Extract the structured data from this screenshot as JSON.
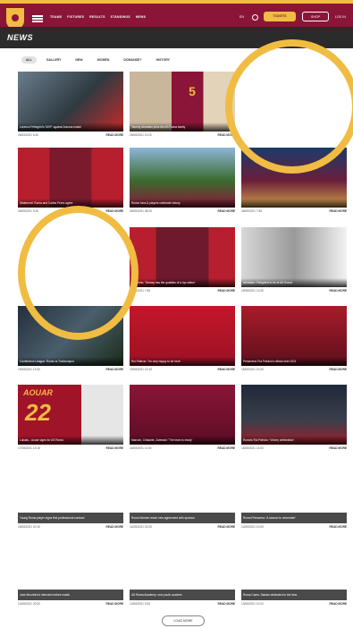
{
  "nav": {
    "items": [
      "TEAMS",
      "FIXTURES",
      "RESULTS",
      "STANDINGS",
      "NEWS"
    ],
    "lang": "EN",
    "tickets_label": "TICKETS",
    "shop_label": "SHOP",
    "login_label": "LOG IN"
  },
  "page": {
    "title": "NEWS",
    "filters": [
      "ALL",
      "GALLERY",
      "NEW",
      "WOMEN",
      "DOMANDE?",
      "HISTORY"
    ],
    "active_filter": 0
  },
  "cards": [
    {
      "caption": "Lorenzo Pellegrini's 'MVP' against Ancona match",
      "date": "26/08/2021 6:40",
      "readmore": "READ MORE"
    },
    {
      "caption": "Tammy Abraham joins the AS Roma family",
      "date": "26/08/2021 10:20",
      "readmore": "READ MORE"
    },
    {
      "caption": "",
      "date": "",
      "readmore": ""
    },
    {
      "caption": "Statement: Roma and Carles Perez agree",
      "date": "26/08/2021 9:30",
      "readmore": "READ MORE"
    },
    {
      "caption": "Roma: fans & players celebrate victory",
      "date": "26/08/2021 08:25",
      "readmore": "READ MORE"
    },
    {
      "caption": "",
      "date": "26/08/2021 7:55",
      "readmore": "READ MORE"
    },
    {
      "caption": "",
      "date": "",
      "readmore": ""
    },
    {
      "caption": "Mourinho: 'Tammy has the qualities of a top striker'",
      "date": "19/08/2021 7:55",
      "readmore": "READ MORE"
    },
    {
      "caption": "Abraham: 'Delighted to be at AS Roma'",
      "date": "19/08/2021 13:30",
      "readmore": "READ MORE"
    },
    {
      "caption": "Conference League: Roma vs Trabzonspor",
      "date": "19/08/2021 13:30",
      "readmore": "READ MORE"
    },
    {
      "caption": "Rui Patricio: 'I'm very happy to be here'",
      "date": "19/08/2021 12:15",
      "readmore": "READ MORE"
    },
    {
      "caption": "Presented: Rui Patricio's official shirt 2021",
      "date": "16/08/2021 10:25",
      "readmore": "READ MORE"
    },
    {
      "caption": "Lukaku - Aouar signs for AS Roma",
      "date": "17/08/2021 13:15",
      "readmore": "READ MORE"
    },
    {
      "caption": "Mancini, Cristante, Zalewski: 'The team is ready'",
      "date": "16/08/2021 11:00",
      "readmore": "READ MORE"
    },
    {
      "caption": "Roma's Rui Patricio: 'Victory celebration'",
      "date": "15/08/2021 13:00",
      "readmore": "READ MORE"
    },
    {
      "caption": "Young Roma player signs first professional contract",
      "date": "15/08/2021 20:15",
      "readmore": "READ MORE"
    },
    {
      "caption": "Roma Women reach new agreement with sponsor",
      "date": "14/08/2021 20:25",
      "readmore": "READ MORE"
    },
    {
      "caption": "Roma Primavera: 'A season to remember'",
      "date": "14/08/2021 10:05",
      "readmore": "READ MORE"
    },
    {
      "caption": "Jose Mourinho's interview before match",
      "date": "13/08/2021 20:00",
      "readmore": "READ MORE"
    },
    {
      "caption": "AS Roma Academy: new youth coaches",
      "date": "13/08/2021 9:05",
      "readmore": "READ MORE"
    },
    {
      "caption": "Roma Cares: Sabato dedicated to the fans",
      "date": "13/08/2021 10:20",
      "readmore": "READ MORE"
    }
  ],
  "load_more_label": "LOAD MORE",
  "colors": {
    "brand": "#8a1538",
    "gold": "#f0bc42",
    "dark": "#2b2b2b"
  }
}
